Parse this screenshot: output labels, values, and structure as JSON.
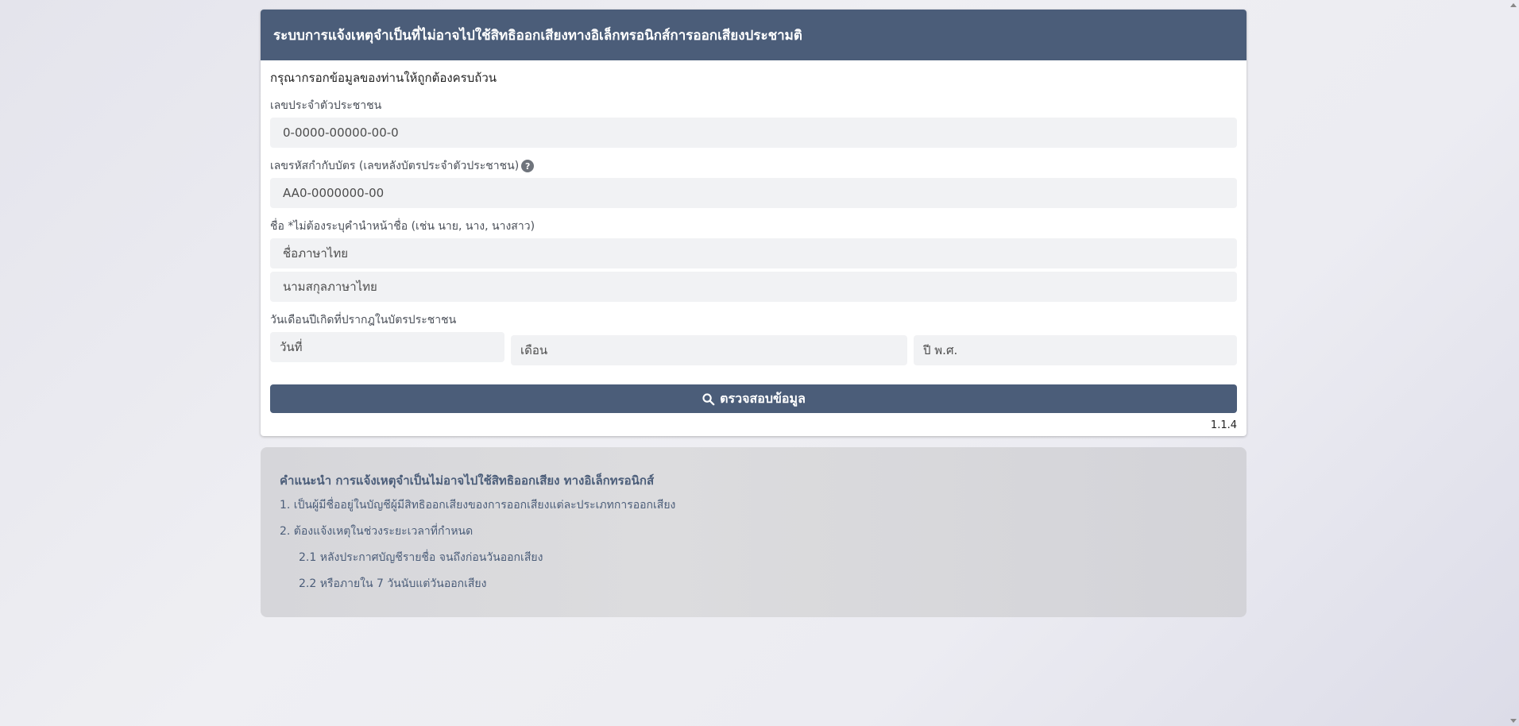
{
  "header": {
    "title": "ระบบการแจ้งเหตุจำเป็นที่ไม่อาจไปใช้สิทธิออกเสียงทางอิเล็กทรอนิกส์การออกเสียงประชามติ"
  },
  "form": {
    "intro": "กรุณากรอกข้อมูลของท่านให้ถูกต้องครบถ้วน",
    "id_card": {
      "label": "เลขประจำตัวประชาชน",
      "placeholder": "0-0000-00000-00-0",
      "value": ""
    },
    "laser_code": {
      "label": "เลขรหัสกำกับบัตร (เลขหลังบัตรประจำตัวประชาชน)",
      "help_icon": "question-circle-icon",
      "placeholder": "AA0-0000000-00",
      "value": ""
    },
    "name": {
      "label": "ชื่อ *ไม่ต้องระบุคำนำหน้าชื่อ (เช่น นาย, นาง, นางสาว)",
      "first_placeholder": "ชื่อภาษาไทย",
      "last_placeholder": "นามสกุลภาษาไทย"
    },
    "birthdate": {
      "label": "วันเดือนปีเกิดที่ปรากฎในบัตรประชาชน",
      "day_placeholder": "วันที่",
      "month_placeholder": "เดือน",
      "year_placeholder": "ปี พ.ศ."
    },
    "submit_icon": "search-icon",
    "submit_label": "ตรวจสอบข้อมูล",
    "version": "1.1.4"
  },
  "advice": {
    "title": "คำแนะนำ การแจ้งเหตุจำเป็นไม่อาจไปใช้สิทธิออกเสียง ทางอิเล็กทรอนิกส์",
    "item1": "1. เป็นผู้มีชื่ออยู่ในบัญชีผู้มีสิทธิออกเสียงของการออกเสียงแต่ละประเภทการออกเสียง",
    "item2": "2. ต้องแจ้งเหตุในช่วงระยะเวลาที่กำหนด",
    "item2_1": "2.1 หลังประกาศบัญชีรายชื่อ จนถึงก่อนวันออกเสียง",
    "item2_2": "2.2 หรือภายใน 7 วันนับแต่วันออกเสียง"
  },
  "colors": {
    "primary": "#4b5d79",
    "input_bg": "#f1f2f4"
  }
}
